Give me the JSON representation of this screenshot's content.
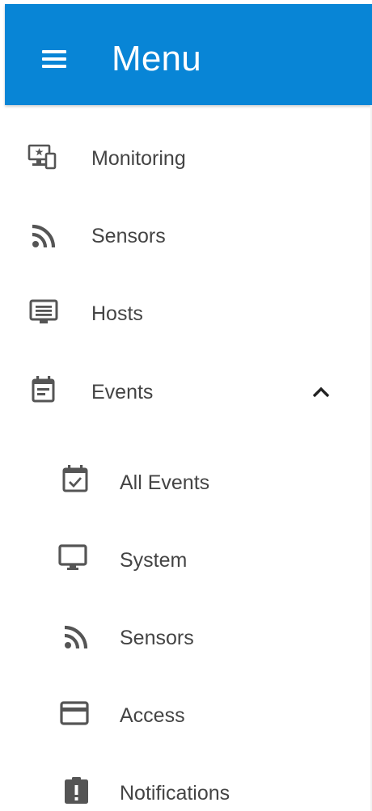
{
  "header": {
    "title": "Menu",
    "menu_icon": "hamburger-menu-icon",
    "background_color": "#0885d6"
  },
  "menu": {
    "items": [
      {
        "label": "Monitoring",
        "icon": "monitoring-devices-icon"
      },
      {
        "label": "Sensors",
        "icon": "rss-feed-icon"
      },
      {
        "label": "Hosts",
        "icon": "host-monitor-icon"
      },
      {
        "label": "Events",
        "icon": "event-note-icon",
        "expanded": true,
        "toggle_icon": "chevron-up-icon"
      }
    ],
    "event_subitems": [
      {
        "label": "All Events",
        "icon": "event-available-icon"
      },
      {
        "label": "System",
        "icon": "desktop-monitor-icon"
      },
      {
        "label": "Sensors",
        "icon": "rss-feed-icon"
      },
      {
        "label": "Access",
        "icon": "credit-card-icon"
      },
      {
        "label": "Notifications",
        "icon": "clipboard-alert-icon"
      }
    ]
  }
}
